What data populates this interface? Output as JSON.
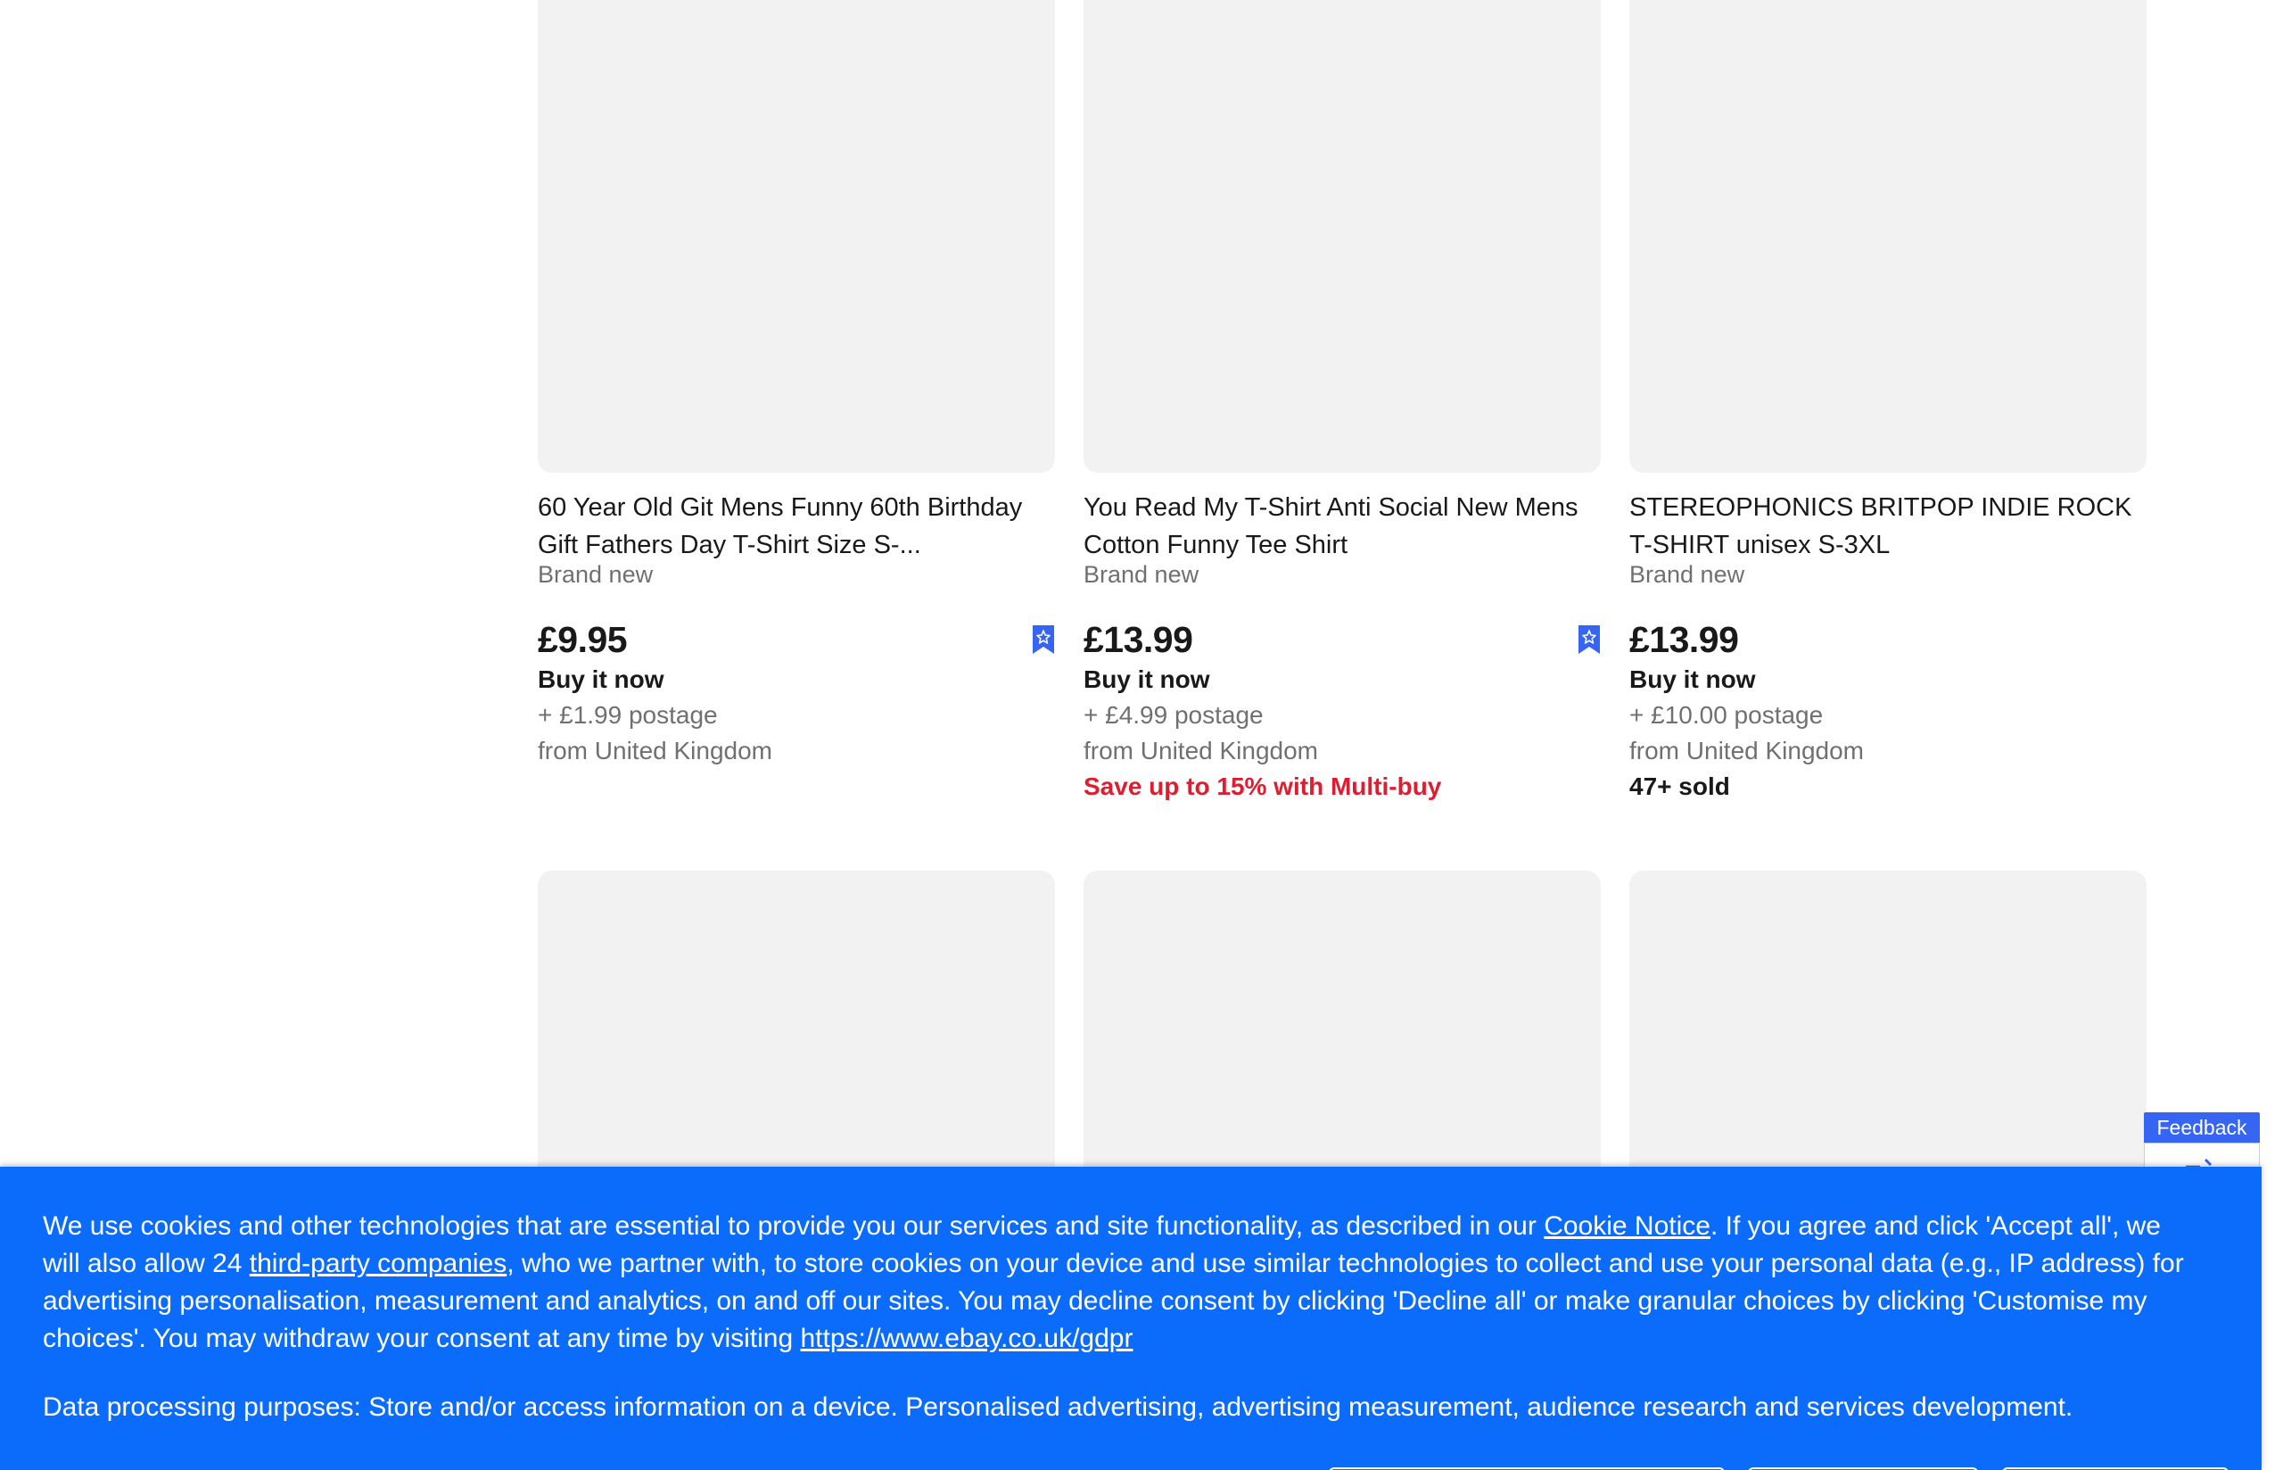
{
  "products": [
    {
      "title": "60 Year Old Git Mens Funny 60th Birthday Gift Fathers Day T-Shirt Size S-...",
      "condition": "Brand new",
      "price": "£9.95",
      "format": "Buy it now",
      "postage": "+ £1.99 postage",
      "location": "from United Kingdom",
      "promo": "",
      "sold": "",
      "watchable": true
    },
    {
      "title": "You Read My T-Shirt Anti Social New Mens Cotton Funny Tee Shirt",
      "condition": "Brand new",
      "price": "£13.99",
      "format": "Buy it now",
      "postage": "+ £4.99 postage",
      "location": "from United Kingdom",
      "promo": "Save up to 15% with Multi-buy",
      "sold": "",
      "watchable": true
    },
    {
      "title": "STEREOPHONICS BRITPOP INDIE ROCK T-SHIRT unisex S-3XL",
      "condition": "Brand new",
      "price": "£13.99",
      "format": "Buy it now",
      "postage": "+ £10.00 postage",
      "location": "from United Kingdom",
      "promo": "",
      "sold": "47+ sold",
      "watchable": false
    }
  ],
  "feedback": {
    "label": "Feedback"
  },
  "cookie_banner": {
    "text_part1": "We use cookies and other technologies that are essential to provide you our services and site functionality, as described in our ",
    "cookie_notice_link": "Cookie Notice",
    "text_part2": ". If you agree and click 'Accept all', we will also allow 24 ",
    "third_party_link": "third-party companies",
    "text_part3": ", who we partner with, to store cookies on your device and use similar technologies to collect and use your personal data (e.g., IP address) for advertising personalisation, measurement and analytics, on and off our sites. You may decline consent by clicking 'Decline all' or make granular choices by clicking 'Customise my choices'. You may withdraw your consent at any time by visiting ",
    "gdpr_link": "https://www.ebay.co.uk/gdpr",
    "purposes": "Data processing purposes: Store and/or access information on a device. Personalised advertising, advertising measurement, audience research and services development."
  },
  "colors": {
    "banner_bg": "#0b6cfb",
    "feedback_bg": "#3665f3",
    "watch_icon": "#3665f3",
    "promo": "#dd1e31",
    "placeholder": "#f2f2f2"
  },
  "icons": {
    "watch": "watchlist-bookmark-icon",
    "feedback": "feedback-icon"
  }
}
